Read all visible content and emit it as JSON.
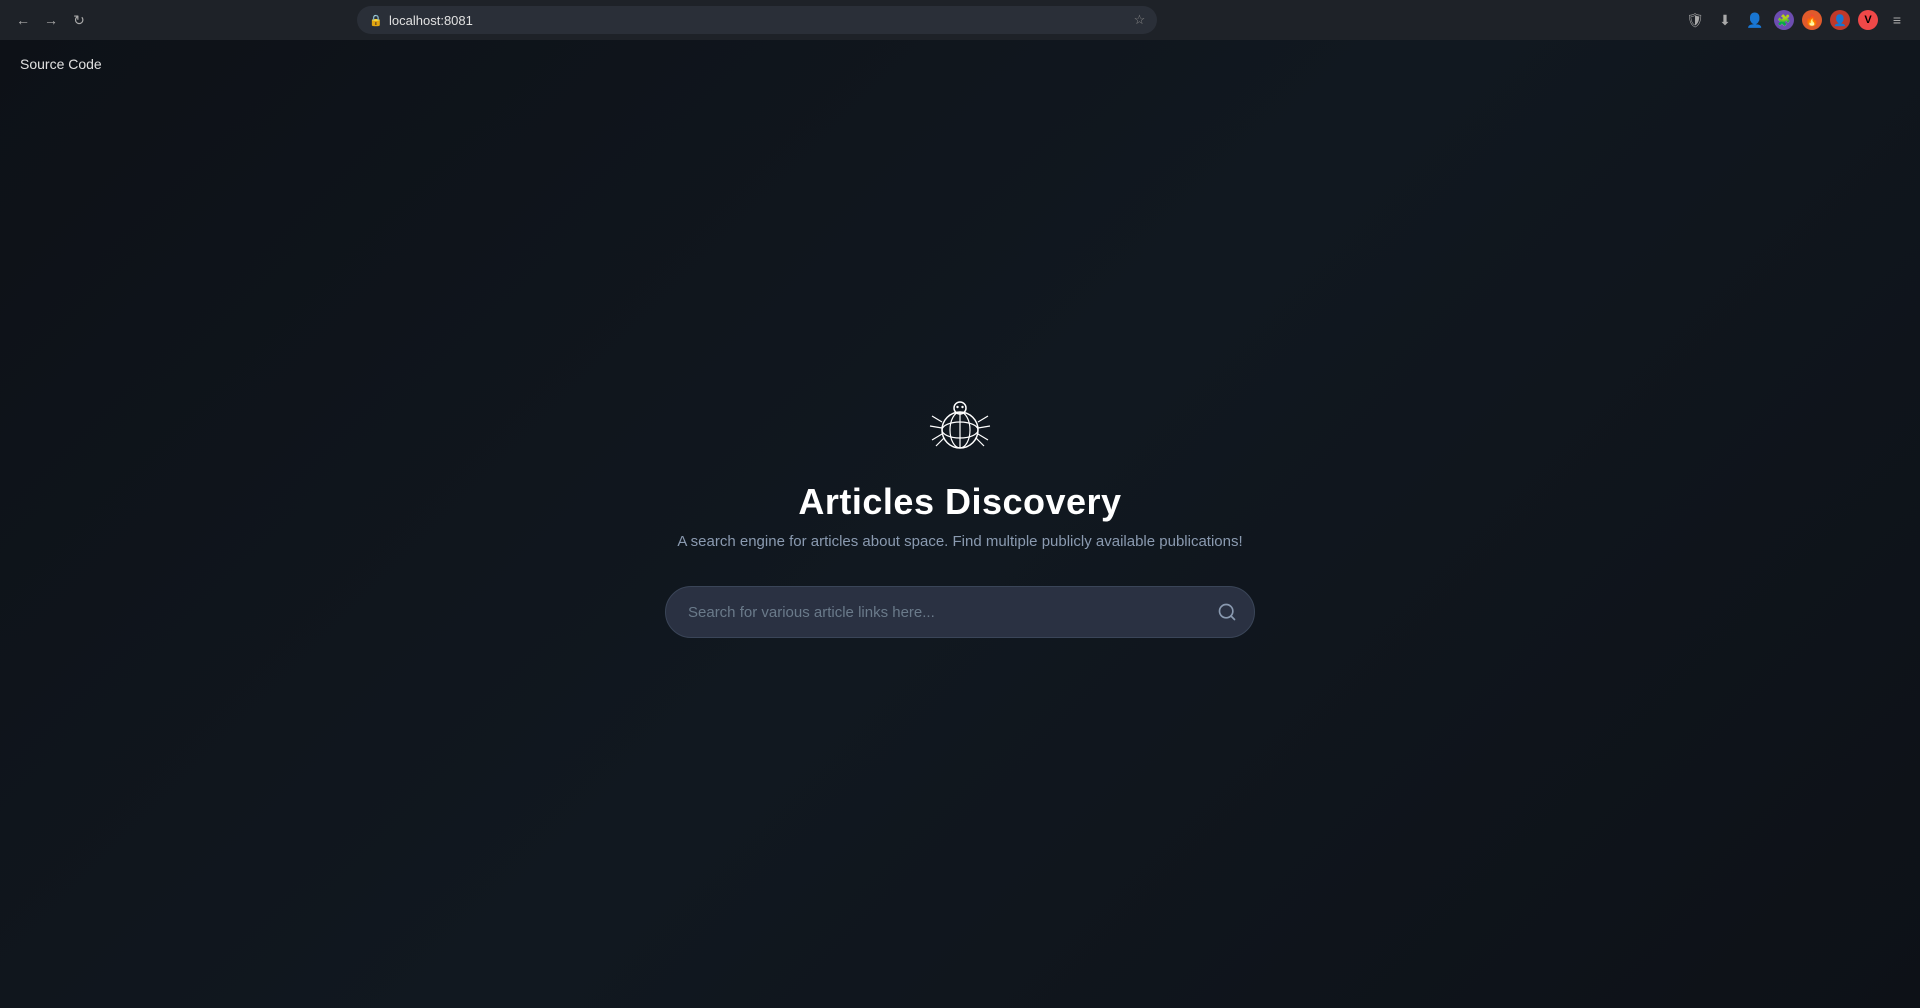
{
  "browser": {
    "url": "localhost:8081",
    "nav": {
      "back_label": "←",
      "forward_label": "→",
      "refresh_label": "↻"
    },
    "right_icons": [
      "shield",
      "download",
      "account",
      "puzzle",
      "fire",
      "person",
      "vivaldi",
      "menu"
    ]
  },
  "nav": {
    "source_code_label": "Source Code"
  },
  "hero": {
    "title": "Articles Discovery",
    "subtitle": "A search engine for articles about space. Find multiple publicly available publications!",
    "search_placeholder": "Search for various article links here..."
  }
}
